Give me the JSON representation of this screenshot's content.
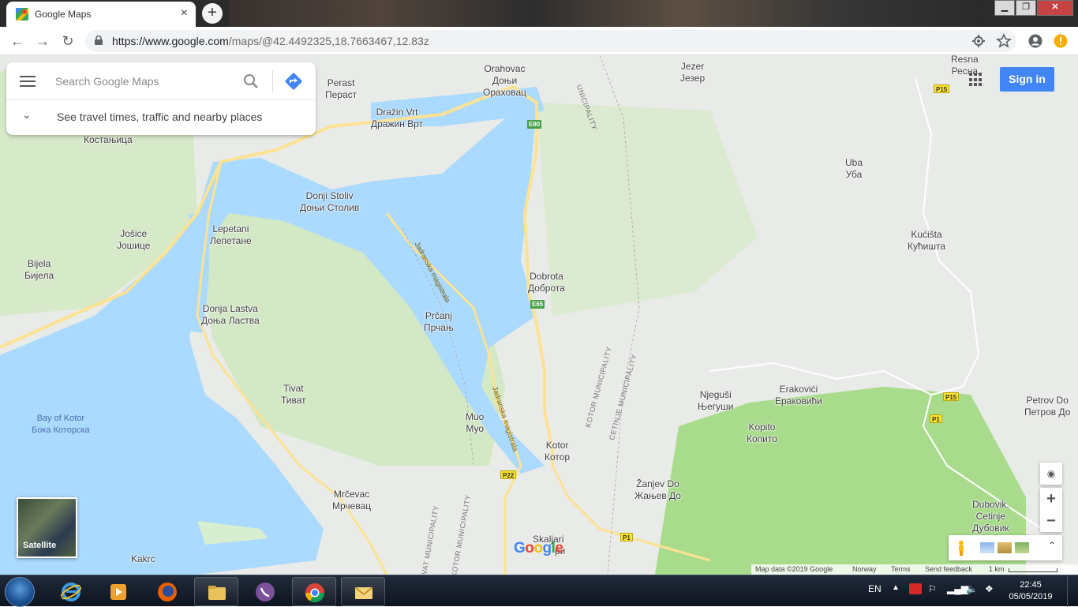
{
  "browser": {
    "tab_title": "Google Maps",
    "tab_close": "×",
    "new_tab": "+",
    "url_host": "https://www.google.com",
    "url_path": "/maps/@42.4492325,18.7663467,12.83z",
    "window_controls": {
      "minimize": "▁",
      "restore": "❐",
      "close": "✕"
    },
    "nav": {
      "back": "←",
      "forward": "→",
      "reload": "↻"
    },
    "toolbar_icons": [
      "location-icon",
      "star-icon",
      "account-icon",
      "alert-icon"
    ]
  },
  "maps": {
    "search_placeholder": "Search Google Maps",
    "travel_prompt": "See travel times, traffic and nearby places",
    "sign_in": "Sign in",
    "satellite_label": "Satellite",
    "logo": "Google",
    "footer": {
      "map_data": "Map data ©2019 Google",
      "country": "Norway",
      "terms": "Terms",
      "feedback": "Send feedback",
      "scale": "1 km"
    },
    "zoom_in": "+",
    "zoom_out": "−",
    "places": {
      "orahovac": [
        "Orahovac",
        "Доњи",
        "Ораховац"
      ],
      "perast": [
        "Perast",
        "Пераст"
      ],
      "drazin": [
        "Dražin Vrt",
        "Дражин Врт"
      ],
      "jezer": [
        "Jezer",
        "Језер"
      ],
      "resna": [
        "Resna",
        "Ресна"
      ],
      "kostanjica": [
        "Костањица"
      ],
      "uba": [
        "Uba",
        "Уба"
      ],
      "donji_stoliv": [
        "Donji Stoliv",
        "Доњи Столив"
      ],
      "lepetani": [
        "Lepetani",
        "Лепетане"
      ],
      "josice": [
        "Jošice",
        "Јошице"
      ],
      "bijela": [
        "Bijela",
        "Бијела"
      ],
      "kucista": [
        "Kućišta",
        "Кућишта"
      ],
      "dobrota": [
        "Dobrota",
        "Доброта"
      ],
      "donja_lastva": [
        "Donja Lastva",
        "Доња Ластва"
      ],
      "prcanj": [
        "Prčanj",
        "Прчањ"
      ],
      "tivat": [
        "Tivat",
        "Тиват"
      ],
      "bay_of_kotor": [
        "Bay of Kotor",
        "Бока Которска"
      ],
      "njegusi": [
        "Njeguši",
        "Његуши"
      ],
      "erakovici": [
        "Erakovići",
        "Ераковићи"
      ],
      "petrov_do": [
        "Petrov Do",
        "Петров До"
      ],
      "muo": [
        "Muo",
        "Муо"
      ],
      "kotor": [
        "Kotor",
        "Котор"
      ],
      "kopito": [
        "Kopito",
        "Копито"
      ],
      "mrcevac": [
        "Mrčevac",
        "Мрчевац"
      ],
      "zanjev_do": [
        "Žanjev Do",
        "Жањев До"
      ],
      "dubovik": [
        "Dubovik,",
        "Cetinje",
        "Дубовик"
      ],
      "skaljari": [
        "Skaljari",
        "ри"
      ],
      "kakrc": [
        "Kakrc"
      ]
    },
    "municipality_labels": {
      "top": "UNICIPALITY",
      "kotor": "KOTOR MUNICIPALITY",
      "cetinje": "CETINJE MUNICIPALITY",
      "bottom_left": "IVAT MUNICIPALITY",
      "bottom_mid": "KOTOR MUNICIPALITY",
      "bottom_tiny": "MUNICIPALITY"
    },
    "road_names": {
      "north": "Jadranska magistrala",
      "south": "Jadranska magistrala"
    },
    "shields": [
      {
        "id": "e80",
        "label": "E80",
        "color": "green"
      },
      {
        "id": "e65",
        "label": "E65",
        "color": "green"
      },
      {
        "id": "p15a",
        "label": "P15",
        "color": "yellow"
      },
      {
        "id": "p15b",
        "label": "P15",
        "color": "yellow"
      },
      {
        "id": "p1a",
        "label": "P1",
        "color": "yellow"
      },
      {
        "id": "p1b",
        "label": "P1",
        "color": "yellow"
      },
      {
        "id": "p22",
        "label": "P22",
        "color": "yellow"
      },
      {
        "id": "e65_top",
        "label": "E65",
        "color": "green"
      }
    ]
  },
  "taskbar": {
    "language": "EN",
    "time": "22:45",
    "date": "05/05/2019",
    "apps": [
      "internet-explorer",
      "media-player",
      "firefox",
      "file-explorer",
      "viber",
      "chrome",
      "mail"
    ]
  },
  "colors": {
    "water": "#aadaff",
    "land": "#e8ebe7",
    "park": "#c8e6b0",
    "forest": "#a8dc8c",
    "road_major": "#fde293",
    "accent": "#4285f4"
  }
}
